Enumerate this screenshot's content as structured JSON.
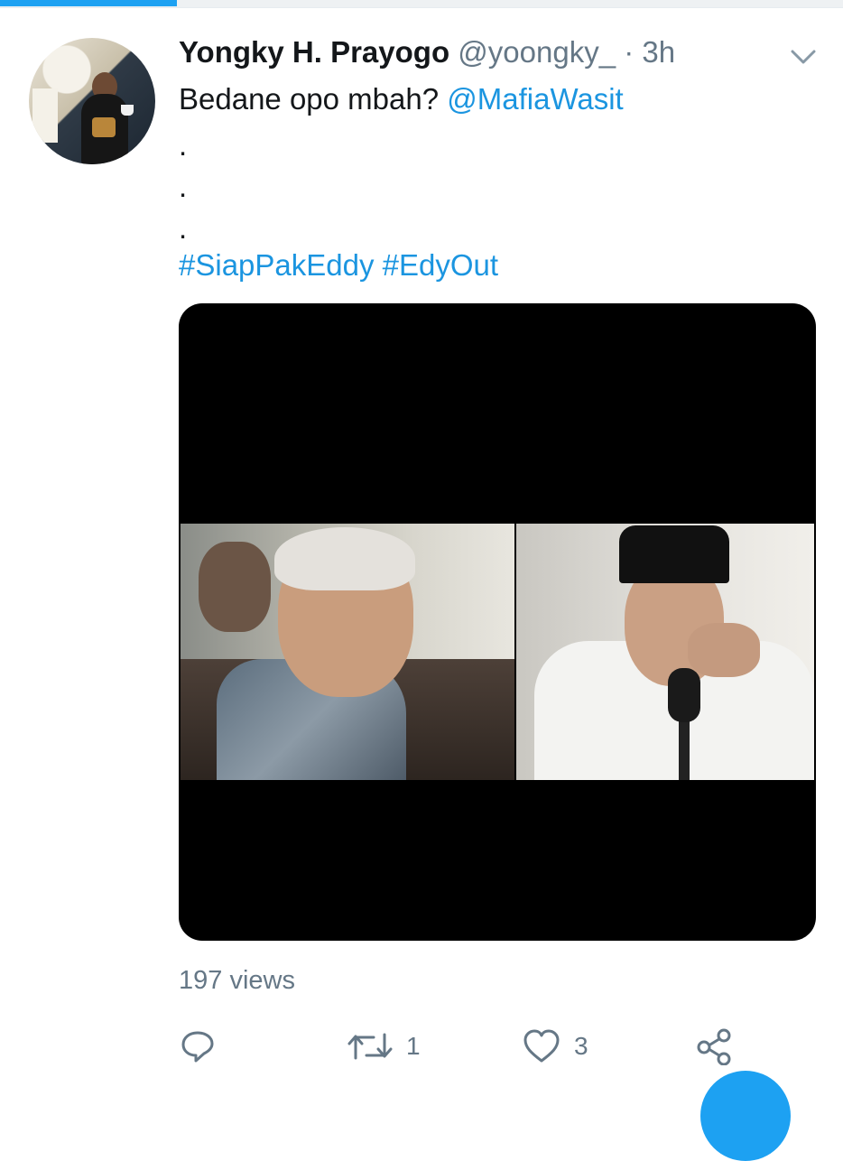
{
  "progress": {
    "value_percent": 21
  },
  "tweet": {
    "author": {
      "display_name": "Yongky H. Prayogo",
      "handle": "@yoongky_"
    },
    "separator": "·",
    "time": "3h",
    "text": "Bedane opo mbah?",
    "mention": "@MafiaWasit",
    "dots": [
      ".",
      ".",
      "."
    ],
    "hashtags": [
      "#SiapPakEddy",
      "#EdyOut"
    ],
    "views": "197 views",
    "actions": {
      "replies": "",
      "retweets": "1",
      "likes": "3"
    }
  },
  "colors": {
    "accent": "#1da1f2",
    "link": "#1b95e0",
    "muted": "#657786",
    "text": "#14171a"
  },
  "icons": {
    "menu": "chevron-down-icon",
    "reply": "reply-icon",
    "retweet": "retweet-icon",
    "like": "heart-icon",
    "share": "share-icon"
  }
}
